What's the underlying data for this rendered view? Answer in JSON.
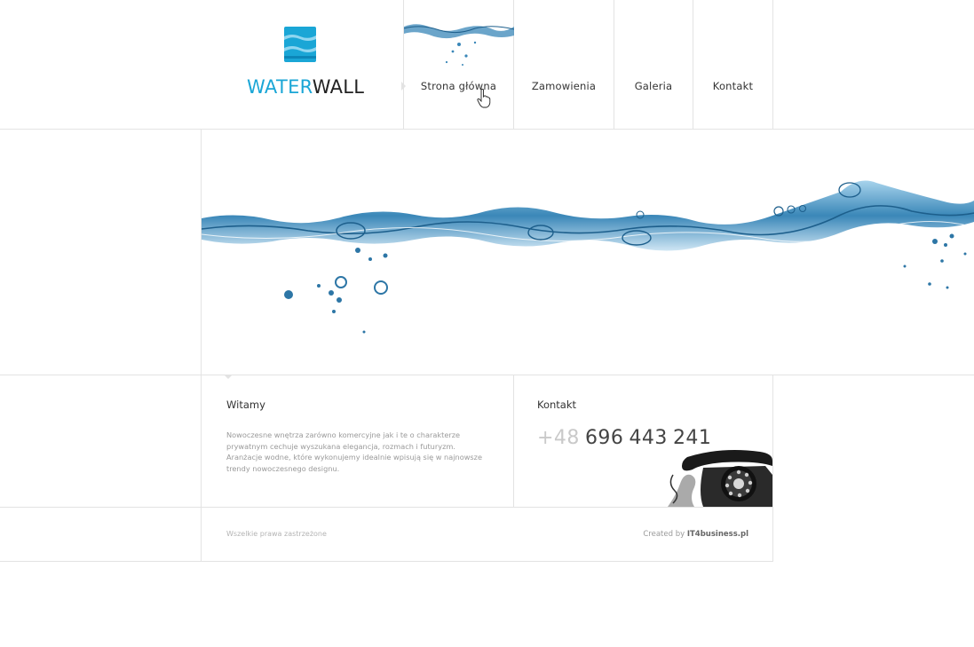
{
  "logo": {
    "part1": "WATER",
    "part2": "WALL"
  },
  "nav": {
    "items": [
      {
        "label": "Strona główna"
      },
      {
        "label": "Zamowienia"
      },
      {
        "label": "Galeria"
      },
      {
        "label": "Kontakt"
      }
    ],
    "active": "Strona główna"
  },
  "welcome": {
    "title": "Witamy",
    "text": "Nowoczesne wnętrza zarówno komercyjne jak i te o charakterze prywatnym cechuje wyszukana elegancja, rozmach i futuryzm. Aranżacje wodne, które wykonujemy idealnie wpisują się w najnowsze trendy nowoczesnego designu."
  },
  "contact": {
    "title": "Kontakt",
    "phone_prefix": "+48",
    "phone_groups": [
      "696",
      "443",
      "241"
    ]
  },
  "footer": {
    "copyright": "Wszelkie prawa zastrzeżone",
    "credit_prefix": "Created by",
    "credit_name": "IT4business.pl"
  },
  "colors": {
    "accent": "#1aa6d6",
    "water": "#3a87b8",
    "border": "#e3e3e3"
  },
  "icons": {
    "logo": "water-layers-icon",
    "cursor": "hand-cursor-icon",
    "phone": "rotary-phone-icon"
  }
}
